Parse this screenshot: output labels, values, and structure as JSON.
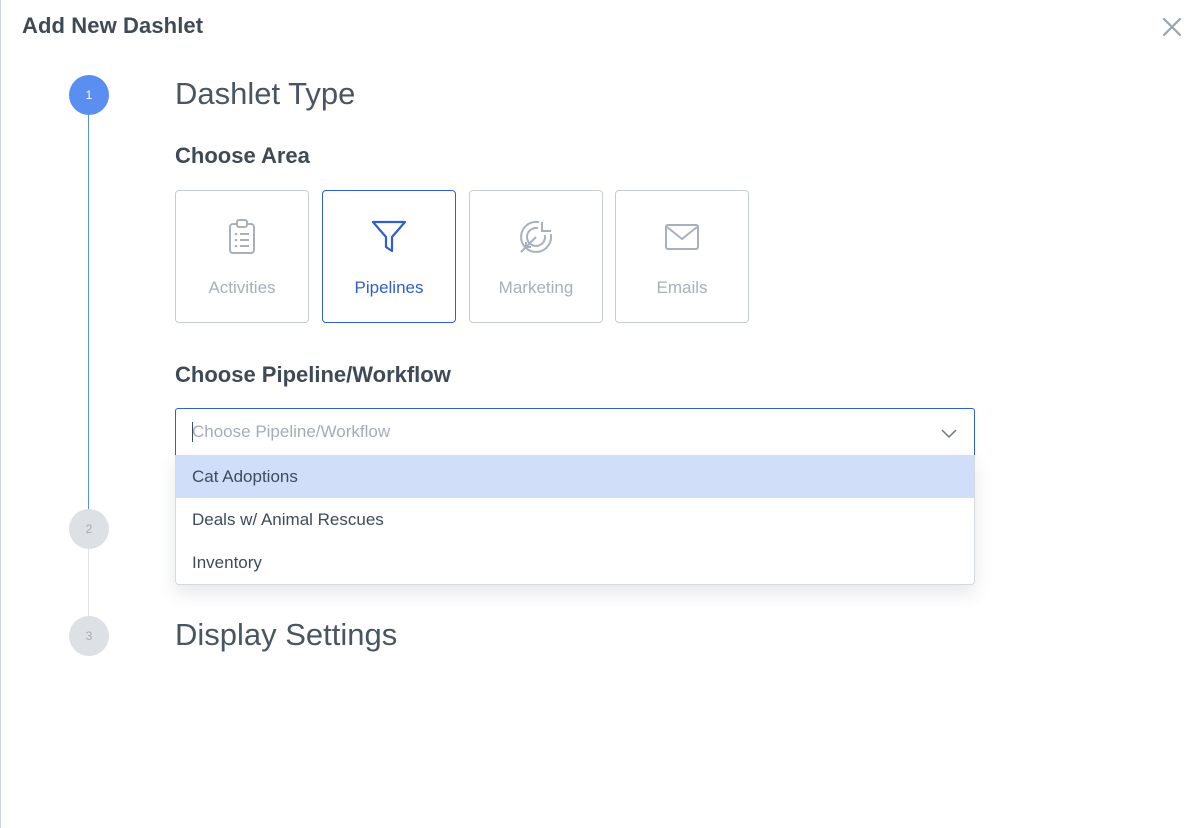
{
  "modal": {
    "title": "Add New Dashlet",
    "close_icon": "close-icon"
  },
  "steps": [
    {
      "number": "1",
      "title": "Dashlet Type",
      "state": "active"
    },
    {
      "number": "2",
      "title": "",
      "state": "inactive"
    },
    {
      "number": "3",
      "title": "Display Settings",
      "state": "inactive"
    }
  ],
  "choose_area": {
    "heading": "Choose Area",
    "cards": [
      {
        "label": "Activities",
        "icon": "clipboard-icon",
        "selected": false
      },
      {
        "label": "Pipelines",
        "icon": "funnel-icon",
        "selected": true
      },
      {
        "label": "Marketing",
        "icon": "target-icon",
        "selected": false
      },
      {
        "label": "Emails",
        "icon": "envelope-icon",
        "selected": false
      }
    ]
  },
  "pipeline_select": {
    "heading": "Choose Pipeline/Workflow",
    "placeholder": "Choose Pipeline/Workflow",
    "value": "",
    "options": [
      {
        "label": "Cat Adoptions",
        "highlighted": true
      },
      {
        "label": "Deals w/ Animal Rescues",
        "highlighted": false
      },
      {
        "label": "Inventory",
        "highlighted": false
      }
    ]
  },
  "colors": {
    "accent": "#2f5fd0",
    "step_active": "#5b8ef1",
    "step_inactive": "#dde1e6",
    "option_highlight": "#d0defa",
    "muted_text": "#a7b0bb"
  }
}
